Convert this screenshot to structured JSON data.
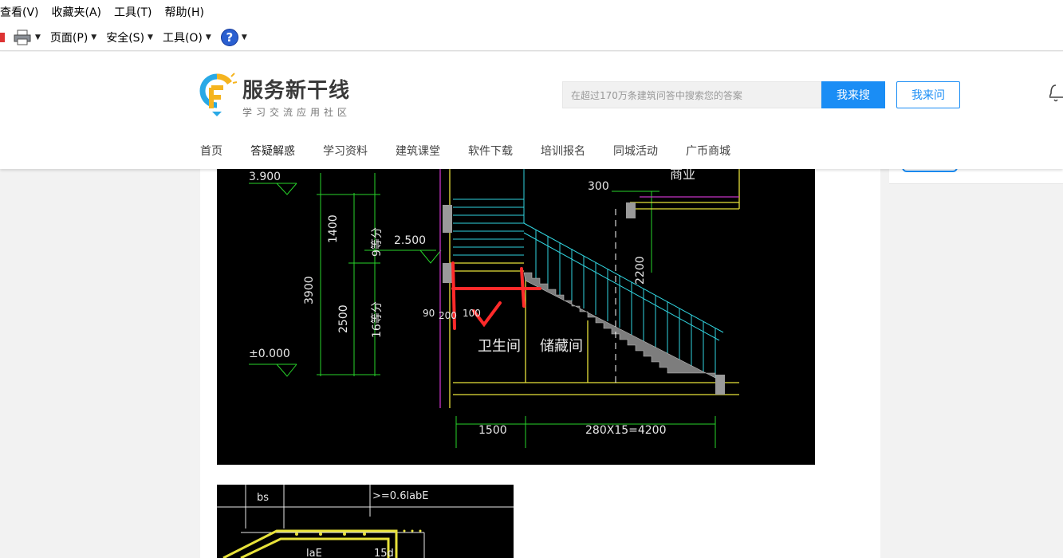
{
  "menu": [
    "查看(V)",
    "收藏夹(A)",
    "工具(T)",
    "帮助(H)"
  ],
  "commandbar": {
    "page_label": "页面(P)",
    "safety_label": "安全(S)",
    "tools_label": "工具(O)",
    "help_glyph": "?"
  },
  "site": {
    "logo_title": "服务新干线",
    "logo_subtitle": "学习交流应用社区",
    "search_placeholder": "在超过170万条建筑问答中搜索您的答案",
    "search_button": "我来搜",
    "ask_button": "我来问",
    "nav": [
      "首页",
      "答疑解惑",
      "学习资料",
      "建筑课堂",
      "软件下载",
      "培训报名",
      "同城活动",
      "广币商城"
    ]
  },
  "drawing1": {
    "labels": {
      "elev_top": "3.900",
      "elev_mid": "2.500",
      "elev_zero": "±0.000",
      "dim_1400": "1400",
      "dim_9parts": "9等分",
      "dim_3900": "3900",
      "dim_2500": "2500",
      "dim_16parts": "16等分",
      "dim_90": "90",
      "dim_200": "200",
      "dim_100": "100",
      "dim_300": "300",
      "dim_2200": "2200",
      "room_bath": "卫生间",
      "room_storage": "储藏间",
      "room_shop": "商业",
      "dim_1500": "1500",
      "dim_steps": "280X15=4200"
    },
    "colors": {
      "dim": "#27d32a",
      "rail": "#31d5e0",
      "slab": "#e8e23a",
      "wall": "#c733c7",
      "markup": "#ff2a2a"
    }
  },
  "drawing2": {
    "labels": {
      "bs": "bs",
      "anchor": ">=0.6labE",
      "lae": "laE",
      "d15": "15d"
    }
  }
}
